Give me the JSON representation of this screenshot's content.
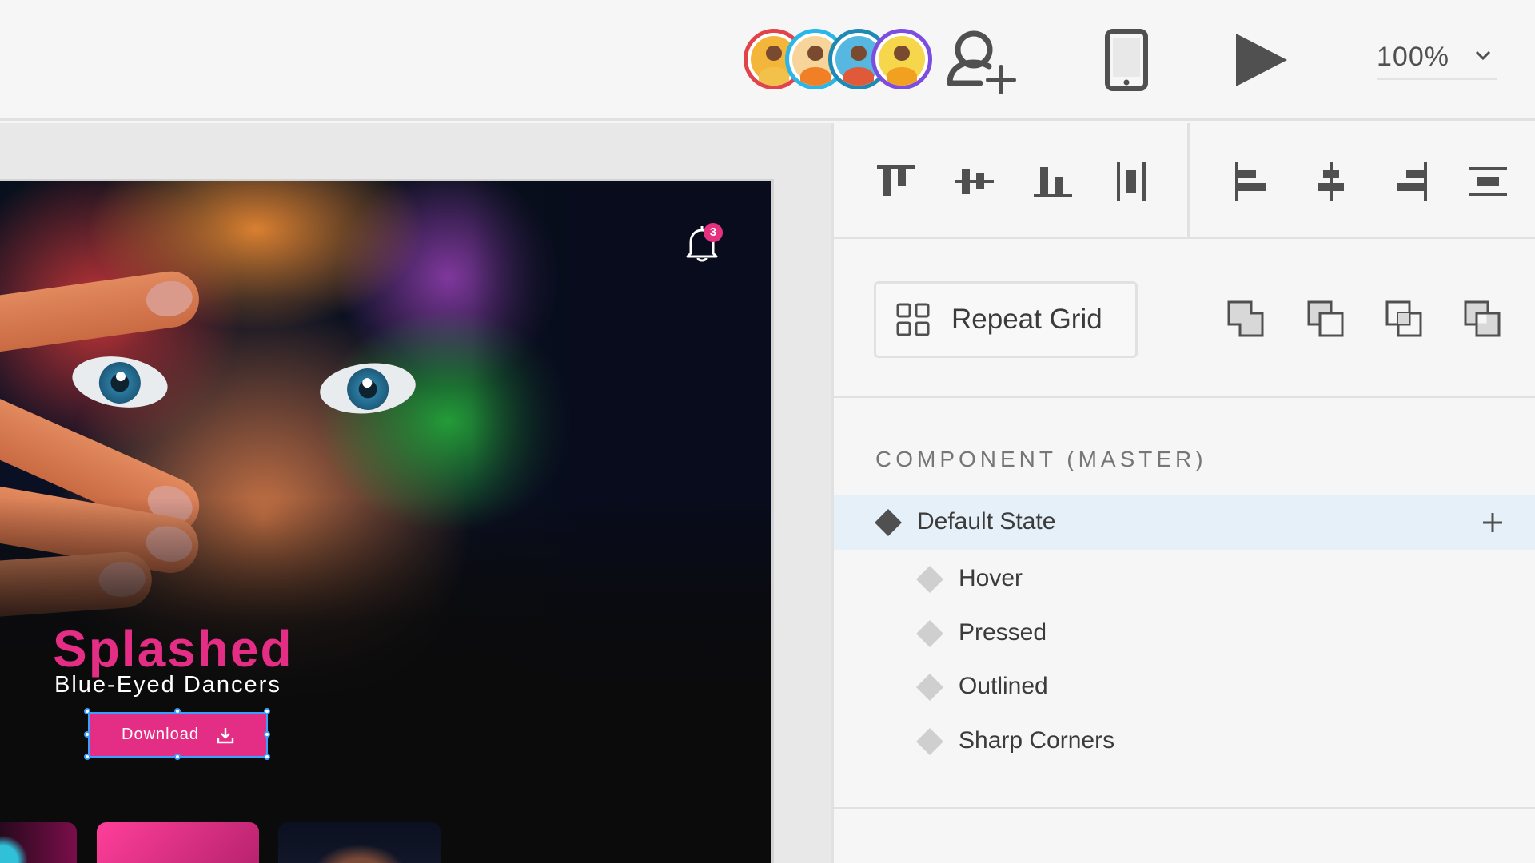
{
  "topbar": {
    "collaborators": [
      {
        "name": "avatar-1",
        "ring": "#e2434b",
        "bg": "#f4b63a",
        "shirt": "#f2c14a"
      },
      {
        "name": "avatar-2",
        "ring": "#2ab6e6",
        "bg": "#f7d49a",
        "shirt": "#f07f25"
      },
      {
        "name": "avatar-3",
        "ring": "#1e89b5",
        "bg": "#56b8e0",
        "shirt": "#e05a3a"
      },
      {
        "name": "avatar-4",
        "ring": "#7c4ee0",
        "bg": "#f6d64a",
        "shirt": "#f2a020"
      }
    ],
    "zoom": "100%"
  },
  "artboard": {
    "notification_count": "3",
    "title": "Splashed",
    "subtitle": "Blue-Eyed Dancers",
    "download_label": "Download"
  },
  "panel": {
    "repeat_grid_label": "Repeat Grid",
    "component_header": "COMPONENT (MASTER)",
    "states": [
      {
        "label": "Default State",
        "active": true
      },
      {
        "label": "Hover",
        "active": false
      },
      {
        "label": "Pressed",
        "active": false
      },
      {
        "label": "Outlined",
        "active": false
      },
      {
        "label": "Sharp Corners",
        "active": false
      }
    ]
  },
  "colors": {
    "accent": "#e42d84",
    "selection": "#3aa0ff",
    "active_row": "#e6f0f8"
  }
}
